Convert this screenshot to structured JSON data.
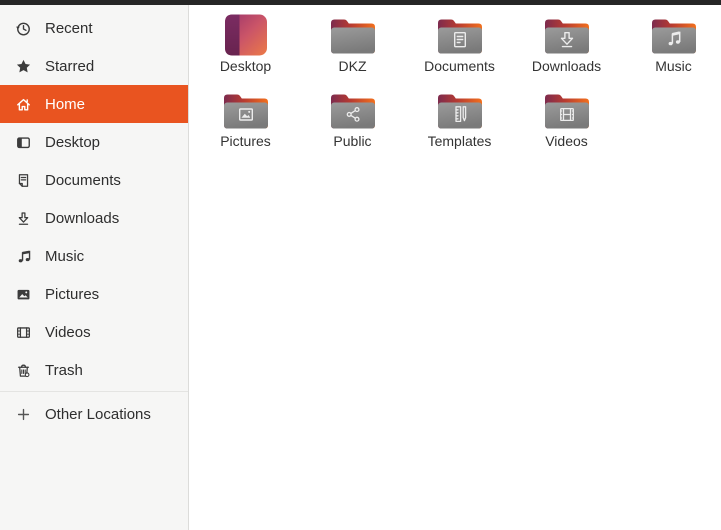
{
  "window": {
    "app": "Files"
  },
  "colors": {
    "accent_orange": "#E95420",
    "topbar": "#262626",
    "sidebar_bg": "#f6f6f5",
    "sidebar_border": "#dcdcda",
    "main_bg": "#ffffff",
    "folder_front_gray": "#8a8a8a",
    "folder_tab_maroon": "#7d2b4e",
    "folder_tab_orange": "#f2701d"
  },
  "sidebar": {
    "items": [
      {
        "id": "recent",
        "label": "Recent",
        "icon": "recent-icon",
        "selected": false
      },
      {
        "id": "starred",
        "label": "Starred",
        "icon": "starred-icon",
        "selected": false
      },
      {
        "id": "home",
        "label": "Home",
        "icon": "home-icon",
        "selected": true
      },
      {
        "id": "desktop",
        "label": "Desktop",
        "icon": "desktop-icon",
        "selected": false
      },
      {
        "id": "documents",
        "label": "Documents",
        "icon": "documents-icon",
        "selected": false
      },
      {
        "id": "downloads",
        "label": "Downloads",
        "icon": "downloads-icon",
        "selected": false
      },
      {
        "id": "music",
        "label": "Music",
        "icon": "music-icon",
        "selected": false
      },
      {
        "id": "pictures",
        "label": "Pictures",
        "icon": "pictures-icon",
        "selected": false
      },
      {
        "id": "videos",
        "label": "Videos",
        "icon": "videos-icon",
        "selected": false
      },
      {
        "id": "trash",
        "label": "Trash",
        "icon": "trash-icon",
        "selected": false
      }
    ],
    "other_locations": {
      "label": "Other Locations",
      "icon": "plus-icon"
    }
  },
  "content": {
    "files": [
      {
        "name": "Desktop",
        "icon": "desktop-gradient-icon",
        "emblem": "none"
      },
      {
        "name": "DKZ",
        "icon": "folder-icon",
        "emblem": "none"
      },
      {
        "name": "Documents",
        "icon": "folder-icon",
        "emblem": "documents"
      },
      {
        "name": "Downloads",
        "icon": "folder-icon",
        "emblem": "downloads"
      },
      {
        "name": "Music",
        "icon": "folder-icon",
        "emblem": "music"
      },
      {
        "name": "Pictures",
        "icon": "folder-icon",
        "emblem": "pictures"
      },
      {
        "name": "Public",
        "icon": "folder-icon",
        "emblem": "share"
      },
      {
        "name": "Templates",
        "icon": "folder-icon",
        "emblem": "templates"
      },
      {
        "name": "Videos",
        "icon": "folder-icon",
        "emblem": "videos"
      }
    ]
  }
}
